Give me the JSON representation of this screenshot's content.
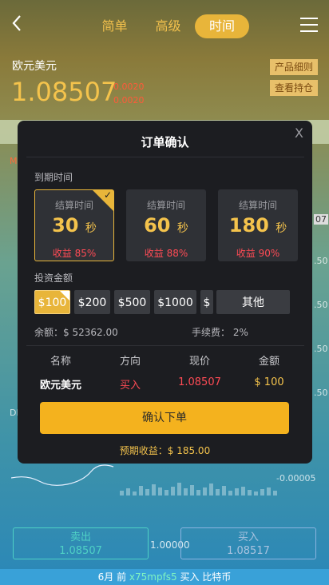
{
  "header": {
    "back_icon": "chevron-left-icon",
    "tabs": [
      {
        "label": "简单"
      },
      {
        "label": "高级"
      },
      {
        "label": "时间"
      }
    ],
    "menu_icon": "hamburger-menu-icon"
  },
  "quote": {
    "pair": "欧元美元",
    "price": "1.08507",
    "change1": "0.0020",
    "change2": "0.0020",
    "product_rules": "产品细则",
    "view_positions": "查看持仓"
  },
  "background": {
    "left_marks": [
      "M",
      "DI"
    ],
    "right_axis": [
      "07",
      ".50",
      ".50",
      ".50",
      ".50"
    ],
    "bottom_axis": "-0.00005",
    "sell_label": "卖出",
    "sell_price": "1.08507",
    "buy_label": "买入",
    "buy_price": "1.08517",
    "mid_value": "1.00000",
    "ticker_prefix": "6月 前 ",
    "ticker_user": "x75mpfs5",
    "ticker_suffix": " 买入 比特币"
  },
  "modal": {
    "title": "订单确认",
    "close_label": "X",
    "expiry_label": "到期时间",
    "expiry_options": [
      {
        "caption": "结算时间",
        "value": "30",
        "unit": "秒",
        "profit": "收益 85%",
        "selected": true
      },
      {
        "caption": "结算时间",
        "value": "60",
        "unit": "秒",
        "profit": "收益 88%",
        "selected": false
      },
      {
        "caption": "结算时间",
        "value": "180",
        "unit": "秒",
        "profit": "收益 90%",
        "selected": false
      }
    ],
    "amount_label": "投资金额",
    "amounts": [
      {
        "label": "$100",
        "selected": true
      },
      {
        "label": "$200",
        "selected": false
      },
      {
        "label": "$500",
        "selected": false
      },
      {
        "label": "$1000",
        "selected": false
      },
      {
        "label": "$",
        "selected": false
      },
      {
        "label": "其他",
        "selected": false
      }
    ],
    "balance": "余额：$ 52362.00",
    "fee": "手续费： 2%",
    "table": {
      "headers": [
        "名称",
        "方向",
        "现价",
        "金额"
      ],
      "row": [
        "欧元美元",
        "买入",
        "1.08507",
        "$ 100"
      ]
    },
    "confirm_label": "确认下单",
    "expected_profit": "预期收益：$ 185.00"
  },
  "colors": {
    "accent": "#f4b21e",
    "gold_text": "#f4c34c",
    "loss_red": "#ff4b55",
    "modal_bg": "#1c1d21"
  }
}
